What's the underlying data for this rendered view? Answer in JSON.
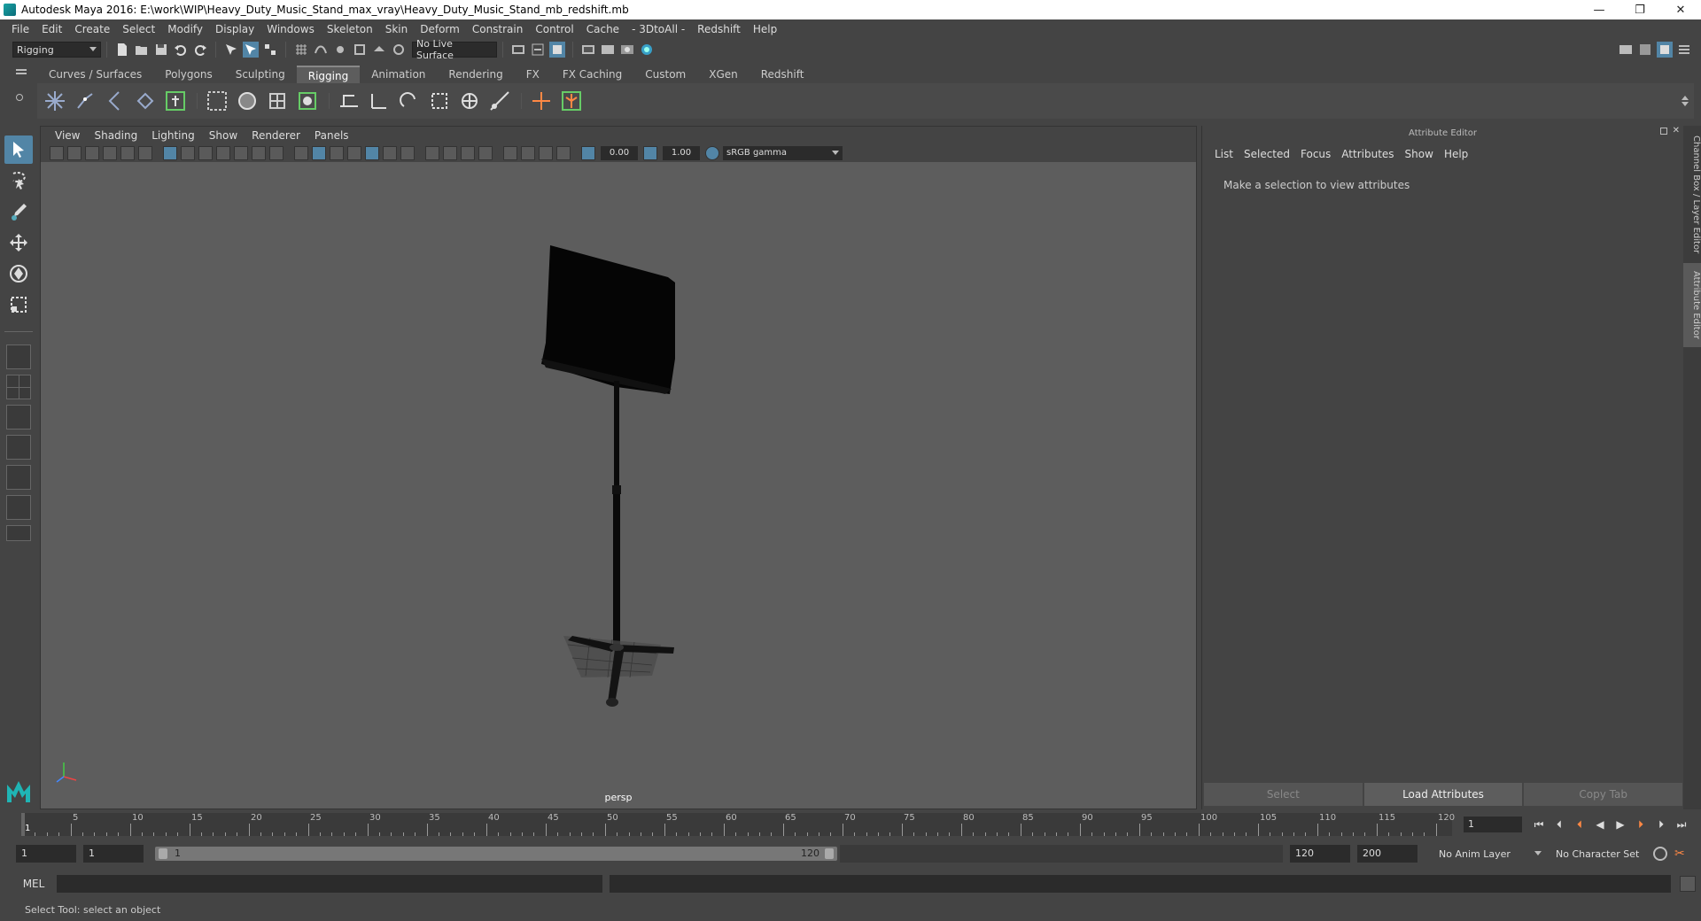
{
  "window": {
    "title": "Autodesk Maya 2016: E:\\work\\WIP\\Heavy_Duty_Music_Stand_max_vray\\Heavy_Duty_Music_Stand_mb_redshift.mb",
    "minimize": "—",
    "restore": "❐",
    "close": "✕"
  },
  "menubar": {
    "items": [
      "File",
      "Edit",
      "Create",
      "Select",
      "Modify",
      "Display",
      "Windows",
      "Skeleton",
      "Skin",
      "Deform",
      "Constrain",
      "Control",
      "Cache",
      "- 3DtoAll -",
      "Redshift",
      "Help"
    ]
  },
  "statusline": {
    "menu_set": "Rigging",
    "live_surface": "No Live Surface"
  },
  "shelf": {
    "tabs": [
      "Curves / Surfaces",
      "Polygons",
      "Sculpting",
      "Rigging",
      "Animation",
      "Rendering",
      "FX",
      "FX Caching",
      "Custom",
      "XGen",
      "Redshift"
    ],
    "active_tab": "Rigging"
  },
  "viewport": {
    "menu": [
      "View",
      "Shading",
      "Lighting",
      "Show",
      "Renderer",
      "Panels"
    ],
    "exposure": "0.00",
    "gamma": "1.00",
    "color_space": "sRGB gamma",
    "camera_label": "persp"
  },
  "attribute_editor": {
    "header": "Attribute Editor",
    "menu": [
      "List",
      "Selected",
      "Focus",
      "Attributes",
      "Show",
      "Help"
    ],
    "message": "Make a selection to view attributes",
    "buttons": {
      "select": "Select",
      "load": "Load Attributes",
      "copy": "Copy Tab"
    }
  },
  "side_tabs": {
    "channel_box": "Channel Box / Layer Editor",
    "attribute_editor": "Attribute Editor"
  },
  "timeslider": {
    "start_label": "1",
    "ticks": [
      "5",
      "10",
      "15",
      "20",
      "25",
      "30",
      "35",
      "40",
      "45",
      "50",
      "55",
      "60",
      "65",
      "70",
      "75",
      "80",
      "85",
      "90",
      "95",
      "100",
      "105",
      "110",
      "115",
      "120"
    ],
    "current_frame": "1"
  },
  "rangeslider": {
    "start_time": "1",
    "playback_start": "1",
    "range_start_label": "1",
    "range_end_label": "120",
    "playback_end": "120",
    "end_time": "200",
    "anim_layer": "No Anim Layer",
    "character_set": "No Character Set"
  },
  "cmdline": {
    "label": "MEL"
  },
  "helpline": {
    "text": "Select Tool: select an object"
  },
  "colors": {
    "accent": "#5285a6",
    "viewport_bg": "#5d5d5d",
    "panel_bg": "#444444"
  }
}
